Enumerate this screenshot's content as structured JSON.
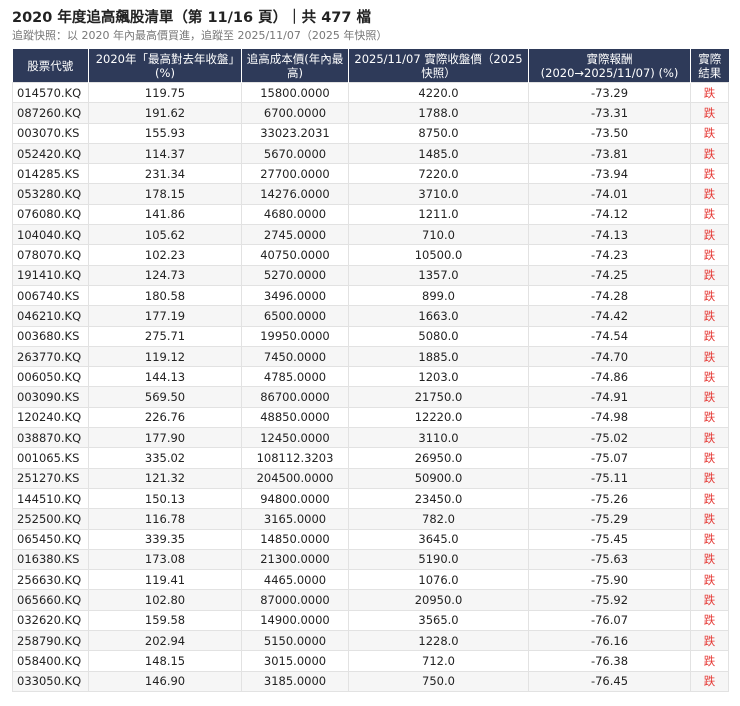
{
  "header": {
    "title": "2020 年度追高飆股清單（第 11/16 頁）｜共 477 檔",
    "subtitle": "追蹤快照：以 2020 年內最高價買進，追蹤至 2025/11/07（2025 年快照）"
  },
  "table": {
    "columns": [
      "股票代號",
      "2020年「最高對去年收盤」(%)",
      "追高成本價(年內最高)",
      "2025/11/07 實際收盤價（2025快照）",
      "實際報酬(2020→2025/11/07) (%)",
      "實際結果"
    ],
    "rows": [
      [
        "014570.KQ",
        "119.75",
        "15800.0000",
        "4220.0",
        "-73.29",
        "跌"
      ],
      [
        "087260.KQ",
        "191.62",
        "6700.0000",
        "1788.0",
        "-73.31",
        "跌"
      ],
      [
        "003070.KS",
        "155.93",
        "33023.2031",
        "8750.0",
        "-73.50",
        "跌"
      ],
      [
        "052420.KQ",
        "114.37",
        "5670.0000",
        "1485.0",
        "-73.81",
        "跌"
      ],
      [
        "014285.KS",
        "231.34",
        "27700.0000",
        "7220.0",
        "-73.94",
        "跌"
      ],
      [
        "053280.KQ",
        "178.15",
        "14276.0000",
        "3710.0",
        "-74.01",
        "跌"
      ],
      [
        "076080.KQ",
        "141.86",
        "4680.0000",
        "1211.0",
        "-74.12",
        "跌"
      ],
      [
        "104040.KQ",
        "105.62",
        "2745.0000",
        "710.0",
        "-74.13",
        "跌"
      ],
      [
        "078070.KQ",
        "102.23",
        "40750.0000",
        "10500.0",
        "-74.23",
        "跌"
      ],
      [
        "191410.KQ",
        "124.73",
        "5270.0000",
        "1357.0",
        "-74.25",
        "跌"
      ],
      [
        "006740.KS",
        "180.58",
        "3496.0000",
        "899.0",
        "-74.28",
        "跌"
      ],
      [
        "046210.KQ",
        "177.19",
        "6500.0000",
        "1663.0",
        "-74.42",
        "跌"
      ],
      [
        "003680.KS",
        "275.71",
        "19950.0000",
        "5080.0",
        "-74.54",
        "跌"
      ],
      [
        "263770.KQ",
        "119.12",
        "7450.0000",
        "1885.0",
        "-74.70",
        "跌"
      ],
      [
        "006050.KQ",
        "144.13",
        "4785.0000",
        "1203.0",
        "-74.86",
        "跌"
      ],
      [
        "003090.KS",
        "569.50",
        "86700.0000",
        "21750.0",
        "-74.91",
        "跌"
      ],
      [
        "120240.KQ",
        "226.76",
        "48850.0000",
        "12220.0",
        "-74.98",
        "跌"
      ],
      [
        "038870.KQ",
        "177.90",
        "12450.0000",
        "3110.0",
        "-75.02",
        "跌"
      ],
      [
        "001065.KS",
        "335.02",
        "108112.3203",
        "26950.0",
        "-75.07",
        "跌"
      ],
      [
        "251270.KS",
        "121.32",
        "204500.0000",
        "50900.0",
        "-75.11",
        "跌"
      ],
      [
        "144510.KQ",
        "150.13",
        "94800.0000",
        "23450.0",
        "-75.26",
        "跌"
      ],
      [
        "252500.KQ",
        "116.78",
        "3165.0000",
        "782.0",
        "-75.29",
        "跌"
      ],
      [
        "065450.KQ",
        "339.35",
        "14850.0000",
        "3645.0",
        "-75.45",
        "跌"
      ],
      [
        "016380.KS",
        "173.08",
        "21300.0000",
        "5190.0",
        "-75.63",
        "跌"
      ],
      [
        "256630.KQ",
        "119.41",
        "4465.0000",
        "1076.0",
        "-75.90",
        "跌"
      ],
      [
        "065660.KQ",
        "102.80",
        "87000.0000",
        "20950.0",
        "-75.92",
        "跌"
      ],
      [
        "032620.KQ",
        "159.58",
        "14900.0000",
        "3565.0",
        "-76.07",
        "跌"
      ],
      [
        "258790.KQ",
        "202.94",
        "5150.0000",
        "1228.0",
        "-76.16",
        "跌"
      ],
      [
        "058400.KQ",
        "148.15",
        "3015.0000",
        "712.0",
        "-76.38",
        "跌"
      ],
      [
        "033050.KQ",
        "146.90",
        "3185.0000",
        "750.0",
        "-76.45",
        "跌"
      ]
    ]
  },
  "colors": {
    "header_bg": "#2e3a59",
    "down": "#e53935"
  }
}
